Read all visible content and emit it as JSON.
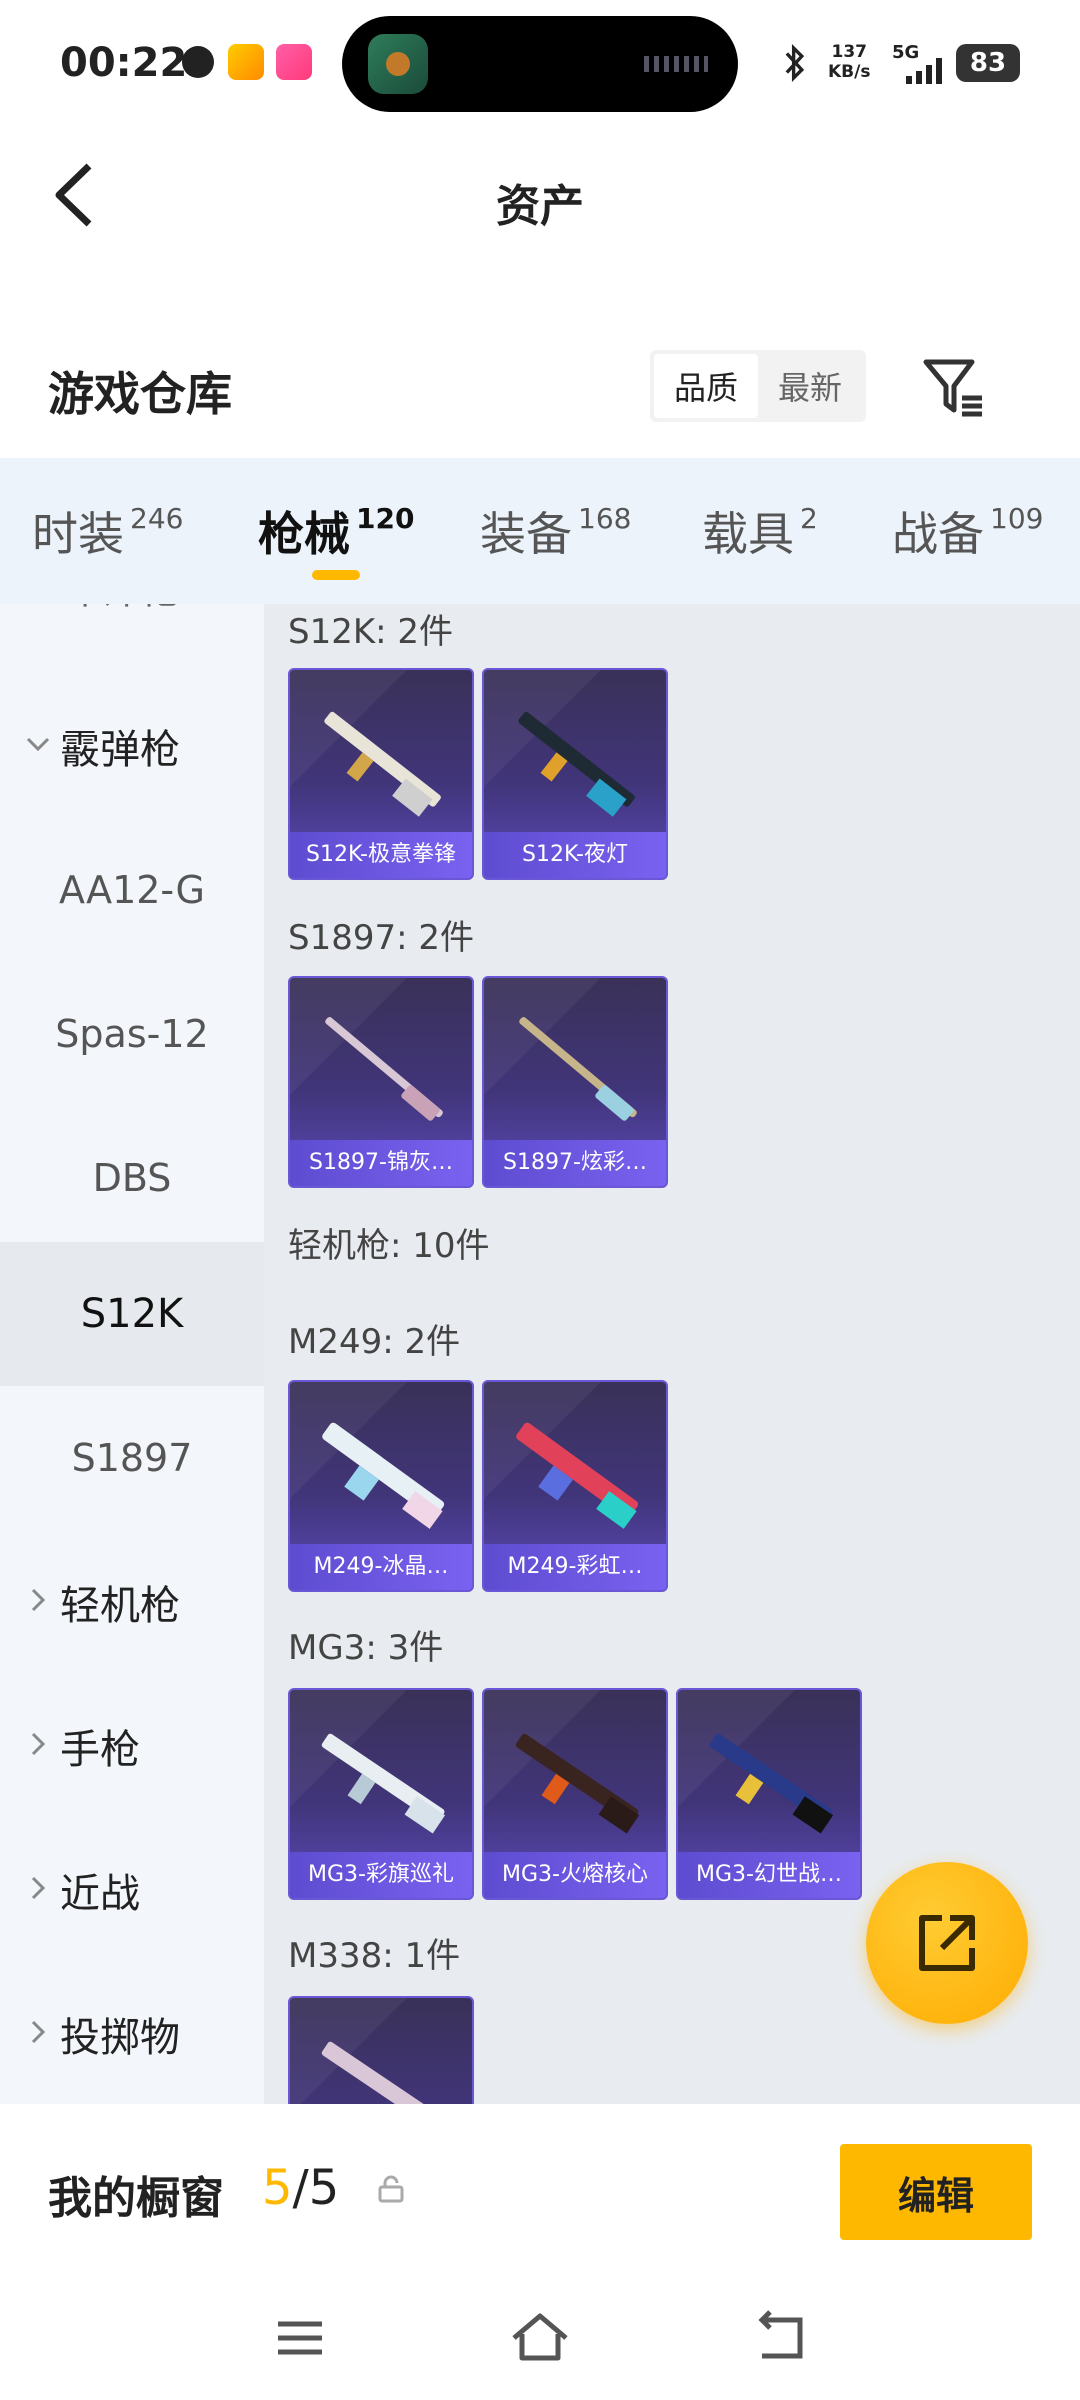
{
  "status_bar": {
    "time": "00:22",
    "net_speed_value": "137",
    "net_speed_unit": "KB/s",
    "network": "5G",
    "battery": "83"
  },
  "header": {
    "title": "资产"
  },
  "warehouse": {
    "title": "游戏仓库",
    "sort_options": [
      "品质",
      "最新"
    ],
    "active_sort": "品质"
  },
  "tabs": [
    {
      "label": "时装",
      "count": "246"
    },
    {
      "label": "枪械",
      "count": "120"
    },
    {
      "label": "装备",
      "count": "168"
    },
    {
      "label": "载具",
      "count": "2"
    },
    {
      "label": "战备",
      "count": "109"
    }
  ],
  "side_nav": {
    "partial_top": "冲锋枪",
    "items": [
      {
        "label": "霰弹枪",
        "kind": "category",
        "expanded": true
      },
      {
        "label": "AA12-G",
        "kind": "sub"
      },
      {
        "label": "Spas-12",
        "kind": "sub"
      },
      {
        "label": "DBS",
        "kind": "sub"
      },
      {
        "label": "S12K",
        "kind": "sub",
        "active": true
      },
      {
        "label": "S1897",
        "kind": "sub"
      },
      {
        "label": "轻机枪",
        "kind": "category"
      },
      {
        "label": "手枪",
        "kind": "category"
      },
      {
        "label": "近战",
        "kind": "category"
      },
      {
        "label": "投掷物",
        "kind": "category"
      }
    ]
  },
  "content": {
    "groups": [
      {
        "label": "S12K: 2件",
        "items": [
          "S12K-极意拳锋",
          "S12K-夜灯"
        ]
      },
      {
        "label": "S1897: 2件",
        "items": [
          "S1897-锦灰…",
          "S1897-炫彩…"
        ]
      },
      {
        "label": "轻机枪: 10件",
        "items": []
      },
      {
        "label": "M249: 2件",
        "items": [
          "M249-冰晶…",
          "M249-彩虹…"
        ]
      },
      {
        "label": "MG3: 3件",
        "items": [
          "MG3-彩旗巡礼",
          "MG3-火熔核心",
          "MG3-幻世战…"
        ]
      },
      {
        "label": "M338: 1件",
        "items": [
          ""
        ]
      }
    ]
  },
  "bottom": {
    "showcase_label": "我的橱窗",
    "current": "5",
    "separator": "/",
    "total": "5",
    "edit_label": "编辑"
  },
  "colors": {
    "accent": "#ffb800",
    "card_bg": "#41357a",
    "card_label": "#6a57e6"
  }
}
